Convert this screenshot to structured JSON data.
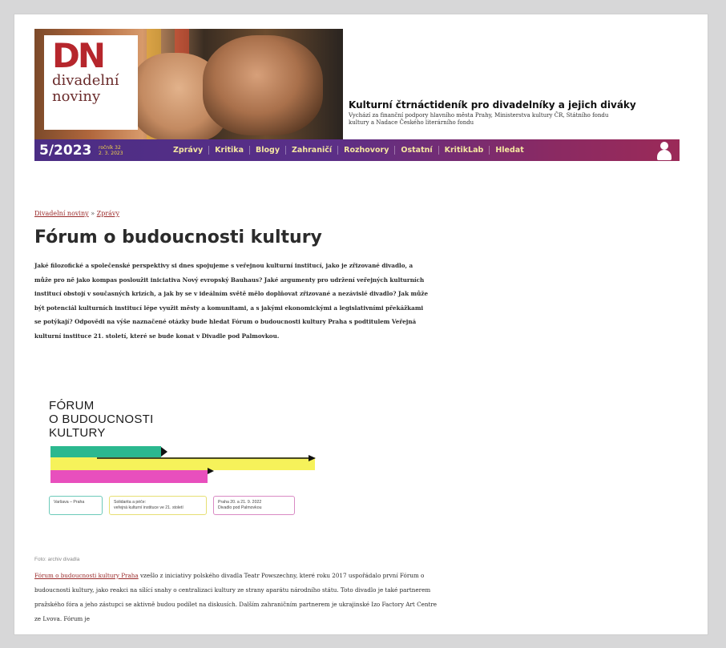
{
  "header": {
    "logo": {
      "mark": "DN",
      "name_line1": "divadelní",
      "name_line2": "noviny"
    },
    "tagline_title": "Kulturní čtrnáctideník pro divadelníky a jejich diváky",
    "tagline_sub": "Vychází za finanční podpory hlavního města Prahy, Ministerstva kultury ČR, Státního fondu kultury a Nadace Českého literárního fondu",
    "issue": "5/2023",
    "issue_meta_line1": "ročník 32",
    "issue_meta_line2": "2. 3. 2023",
    "nav": [
      "Zprávy",
      "Kritika",
      "Blogy",
      "Zahraničí",
      "Rozhovory",
      "Ostatní",
      "KritikLab",
      "Hledat"
    ]
  },
  "breadcrumb": {
    "home": "Divadelní noviny",
    "separator": "»",
    "current": "Zprávy"
  },
  "article": {
    "title": "Fórum o budoucnosti kultury",
    "lead": "Jaké filozofické a společenské perspektivy si dnes spojujeme s veřejnou kulturní institucí, jako je zřizované divadlo, a může pro ně jako kompas posloužit iniciativa Nový evropský Bauhaus? Jaké argumenty pro udržení veřejných kulturních institucí obstojí v současných krizích, a jak by se v ideálním světě mělo doplňovat zřizované a nezávislé divadlo? Jak může být potenciál kulturních institucí lépe využit městy a komunitami, a s jakými ekonomickými a legislativními překážkami se potýkají? Odpovědi na výše naznačené otázky bude hledat Fórum o budoucnosti kultury Praha s podtitulem Veřejná kulturní instituce 21. století, které se bude konat v Divadle pod Palmovkou.",
    "graphic": {
      "title_line1": "FÓRUM",
      "title_line2": "O BUDOUCNOSTI",
      "title_line3": "KULTURY",
      "colors": {
        "green": "#2bb88f",
        "yellow": "#f6f25a",
        "pink": "#e84fbd"
      },
      "box1": "Varšava – Praha",
      "box2_line1": "Solidarita a péče:",
      "box2_line2": "veřejná kulturní instituce ve 21. století",
      "box3_line1": "Praha 20. a 21. 9. 2022",
      "box3_line2": "Divadlo pod Palmovkou"
    },
    "caption": "Foto: archiv divadla",
    "body_link": "Fórum o budoucnosti kultury Praha",
    "body_text": " vzešlo z iniciativy polského divadla Teatr Powszechny, které roku 2017 uspořádalo první Fórum o budoucnosti kultury, jako reakci na sílící snahy o centralizaci kultury ze strany aparátu národního státu. Toto divadlo je také partnerem pražského fóra a jeho zástupci se aktivně budou podílet na diskusích. Dalším zahraničním partnerem je ukrajinské Izo Factory Art Centre ze Lvova. Fórum je"
  }
}
